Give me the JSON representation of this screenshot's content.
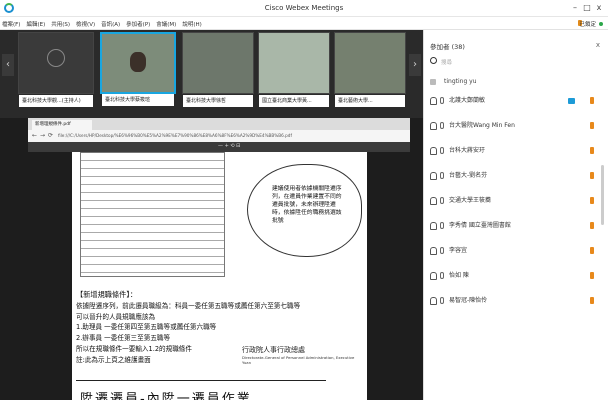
{
  "window": {
    "title": "Cisco Webex Meetings",
    "controls": [
      "–",
      "□",
      "x"
    ]
  },
  "menu": {
    "items": [
      "檔案(F)",
      "編輯(E)",
      "共用(S)",
      "檢視(V)",
      "音訊(A)",
      "參加者(P)",
      "會議(M)",
      "說明(H)"
    ],
    "locked_label": "已鎖定"
  },
  "filmstrip": {
    "tiles": [
      {
        "caption": "臺北科技大學觀...(主持人)"
      },
      {
        "caption": "臺北科技大學蔡筱瑄"
      },
      {
        "caption": "臺北科技大學徐哲"
      },
      {
        "caption": "國立臺北商業大學黃..."
      },
      {
        "caption": "臺北藝術大學..."
      }
    ]
  },
  "browser": {
    "tab_label": "新增理規條件.pdf",
    "url": "file:///C:/Users/HP/Desktop/%E6%96%B0%E5%A2%9E%E7%90%86%E8%A6%8F%E6%A2%9D%E4%BB%B6.pdf",
    "pdf_toolbar": "— + ⟲ ⊟"
  },
  "document": {
    "cloud_text": "建議使用者依據機關陞遷序列，在遷員作業建置不同的遷員批號，未來辦理陞遷時，依據陞任的職務挑選該批號",
    "heading": "【新增規職條件】：",
    "lines": [
      "依據陞遷序列，前此遷員職級為：科員一委任第五職等或薦任第六至第七職等",
      "可以晉升的人員規職應該為",
      "1.助理員 一委任第四至第五職等或薦任第六職等",
      "2.辦事員 一委任第三至第五職等",
      "所以在規職條件一要輸入1.2的規職條件",
      "註:此為示上頁之維護畫面"
    ],
    "seal_name": "行政院人事行政總處",
    "seal_en": "Directorate-General of Personnel Administration, Executive Yuan",
    "bottom_title": "陞遷遷員-內陞一遷員作業"
  },
  "participants": {
    "header": "參加者 (38)",
    "search_placeholder": "搜尋",
    "first": "tingting yu",
    "list": [
      {
        "name": "北護大鄭蘭敏",
        "camera": true
      },
      {
        "name": "台大醫院Wang Min Fen",
        "camera": false
      },
      {
        "name": "台科大蔣安玗",
        "camera": false
      },
      {
        "name": "台藝大-劉名芬",
        "camera": false
      },
      {
        "name": "交通大學王筱蕎",
        "camera": false
      },
      {
        "name": "李秀倩 國立臺灣圖書館",
        "camera": false
      },
      {
        "name": "李容宜",
        "camera": false
      },
      {
        "name": "怡如 陳",
        "camera": false
      },
      {
        "name": "易智冠-陳怡伶",
        "camera": false
      }
    ]
  },
  "colors": {
    "accent": "#19a6e0",
    "status_orange": "#e8891b",
    "online_green": "#2ca74a"
  }
}
